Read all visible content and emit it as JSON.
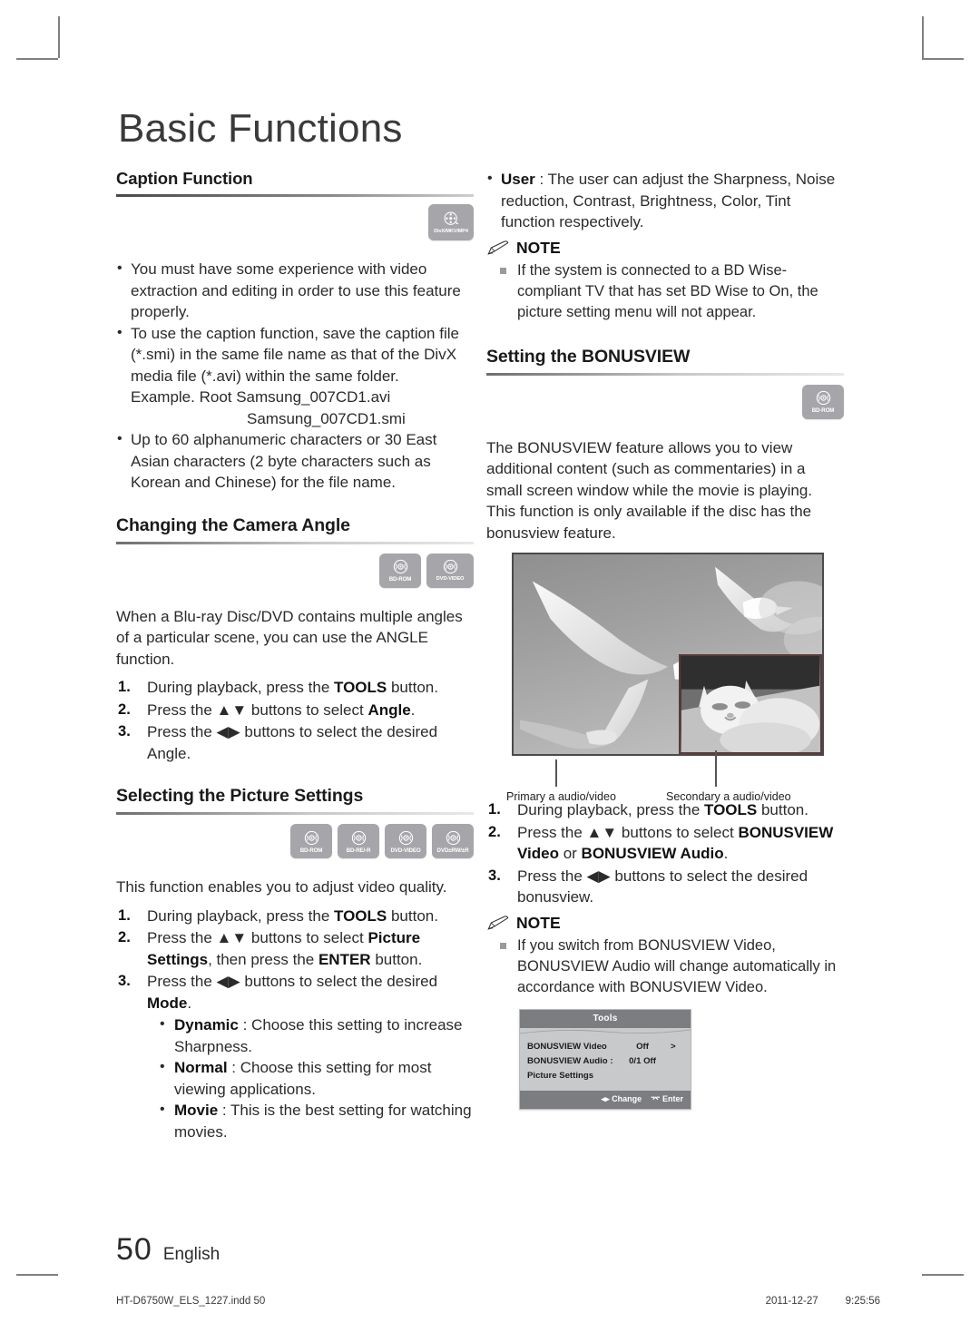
{
  "document": {
    "chapter_title": "Basic Functions",
    "page_number": "50",
    "language": "English",
    "imprint_file": "HT-D6750W_ELS_1227.indd   50",
    "imprint_date": "2011-12-27",
    "imprint_time": "9:25:56"
  },
  "left_column": {
    "caption_function": {
      "heading": "Caption Function",
      "badges": [
        {
          "name": "divx-mkv-mp4-badge",
          "label": "DivX/MKV/MP4"
        }
      ],
      "bullets": [
        "You must have some experience with video extraction and editing in order to use this feature properly.",
        "To use the caption function, save the caption file (*.smi) in the same file name as that of the DivX media file (*.avi) within the same folder.",
        "Up to 60 alphanumeric characters or 30 East Asian characters (2 byte characters such as Korean and Chinese) for the file name."
      ],
      "example_line1": "Example. Root Samsung_007CD1.avi",
      "example_line2": "Samsung_007CD1.smi"
    },
    "camera_angle": {
      "heading": "Changing the Camera Angle",
      "badges": [
        {
          "name": "bd-rom-badge",
          "label": "BD-ROM"
        },
        {
          "name": "dvd-video-badge",
          "label": "DVD-VIDEO"
        }
      ],
      "intro": "When a Blu-ray Disc/DVD contains multiple angles of a particular scene, you can use the ANGLE function.",
      "steps": [
        {
          "pre": "During playback, press the ",
          "bold": "TOOLS",
          "post": " button."
        },
        {
          "pre": "Press the ▲▼ buttons to select ",
          "bold": "Angle",
          "post": "."
        },
        {
          "pre": "Press the ◀▶ buttons to select the desired Angle.",
          "bold": "",
          "post": ""
        }
      ]
    },
    "picture_settings": {
      "heading": "Selecting the Picture Settings",
      "badges": [
        {
          "name": "bd-rom-badge",
          "label": "BD-ROM"
        },
        {
          "name": "bd-re-r-badge",
          "label": "BD-RE/-R"
        },
        {
          "name": "dvd-video-badge",
          "label": "DVD-VIDEO"
        },
        {
          "name": "dvd-rw-r-badge",
          "label": "DVD±RW/±R"
        }
      ],
      "intro": "This function enables you to adjust video quality.",
      "step1": {
        "pre": "During playback, press the ",
        "bold": "TOOLS",
        "post": " button."
      },
      "step2": {
        "pre": "Press the ▲▼ buttons to select ",
        "bold": "Picture Settings",
        "mid": ", then press the ",
        "bold2": "ENTER",
        "post": " button."
      },
      "step3": {
        "pre": "Press the ◀▶ buttons to select the desired ",
        "bold": "Mode",
        "post": "."
      },
      "modes": [
        {
          "name": "Dynamic",
          "desc": " : Choose this setting to increase Sharpness."
        },
        {
          "name": "Normal",
          "desc": " : Choose this setting for most viewing applications."
        },
        {
          "name": "Movie",
          "desc": " : This is the best setting for watching movies."
        }
      ]
    }
  },
  "right_column": {
    "user_mode": {
      "name": "User",
      "desc": " : The user can adjust the Sharpness, Noise reduction, Contrast, Brightness, Color, Tint function respectively."
    },
    "note1": {
      "heading": "NOTE",
      "items": [
        "If the system is connected to a BD Wise-compliant TV that has set BD Wise to On, the picture setting menu will not appear."
      ]
    },
    "bonusview": {
      "heading": "Setting the BONUSVIEW",
      "badges": [
        {
          "name": "bd-rom-badge",
          "label": "BD-ROM"
        }
      ],
      "intro": "The BONUSVIEW feature allows you to view additional content (such as commentaries) in a small screen window while the movie is playing. This function is only available if the disc has the bonusview feature.",
      "figure": {
        "primary_caption": "Primary a audio/video",
        "secondary_caption": "Secondary a audio/video"
      },
      "step1": {
        "pre": "During playback, press the ",
        "bold": "TOOLS",
        "post": " button."
      },
      "step2": {
        "pre": "Press the ▲▼ buttons to select ",
        "bold": "BONUSVIEW Video",
        "mid": " or ",
        "bold2": "BONUSVIEW Audio",
        "post": "."
      },
      "step3": {
        "pre": "Press the ◀▶ buttons to select the desired bonusview.",
        "bold": "",
        "post": ""
      }
    },
    "note2": {
      "heading": "NOTE",
      "items": [
        "If you switch from BONUSVIEW Video, BONUSVIEW Audio will change automatically in accordance with BONUSVIEW Video."
      ]
    },
    "osd": {
      "title": "Tools",
      "rows": [
        {
          "label": "BONUSVIEW Video",
          "arrow_left": "<",
          "value": "Off",
          "arrow_right": ">"
        },
        {
          "label": "BONUSVIEW Audio :",
          "arrow_left": "",
          "value": "0/1 Off",
          "arrow_right": ""
        },
        {
          "label": "Picture Settings",
          "arrow_left": "",
          "value": "",
          "arrow_right": ""
        }
      ],
      "footer_change": "Change",
      "footer_enter": "Enter"
    }
  },
  "colors": {
    "badge_gray": "#a6a6aa",
    "osd_header": "#7b7d80",
    "osd_body": "#c7c9cb",
    "text": "#2b2b2b"
  }
}
